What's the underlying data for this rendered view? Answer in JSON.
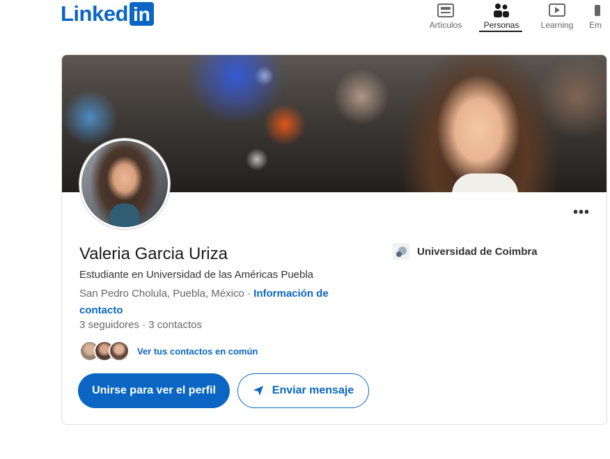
{
  "header": {
    "logo_word": "Linked",
    "logo_in": "in",
    "nav": [
      {
        "label": "Artículos",
        "icon": "articles-icon",
        "active": false
      },
      {
        "label": "Personas",
        "icon": "people-icon",
        "active": true
      },
      {
        "label": "Learning",
        "icon": "learning-icon",
        "active": false
      },
      {
        "label": "Em",
        "icon": "jobs-icon",
        "active": false
      }
    ]
  },
  "profile": {
    "more_label": "•••",
    "name": "Valeria Garcia Uriza",
    "headline": "Estudiante en Universidad de las Américas Puebla",
    "location": "San Pedro Cholula, Puebla, México",
    "separator": " · ",
    "contact_link": "Información de contacto",
    "followers": "3 seguidores",
    "dot": " · ",
    "connections": "3 contactos",
    "mutual_text": "Ver tus contactos en común",
    "join_button": "Unirse para ver el perfil",
    "message_button": "Enviar mensaje",
    "education": "Universidad de Coimbra"
  },
  "colors": {
    "brand": "#0a66c2",
    "text": "#191919",
    "muted": "#666666"
  }
}
